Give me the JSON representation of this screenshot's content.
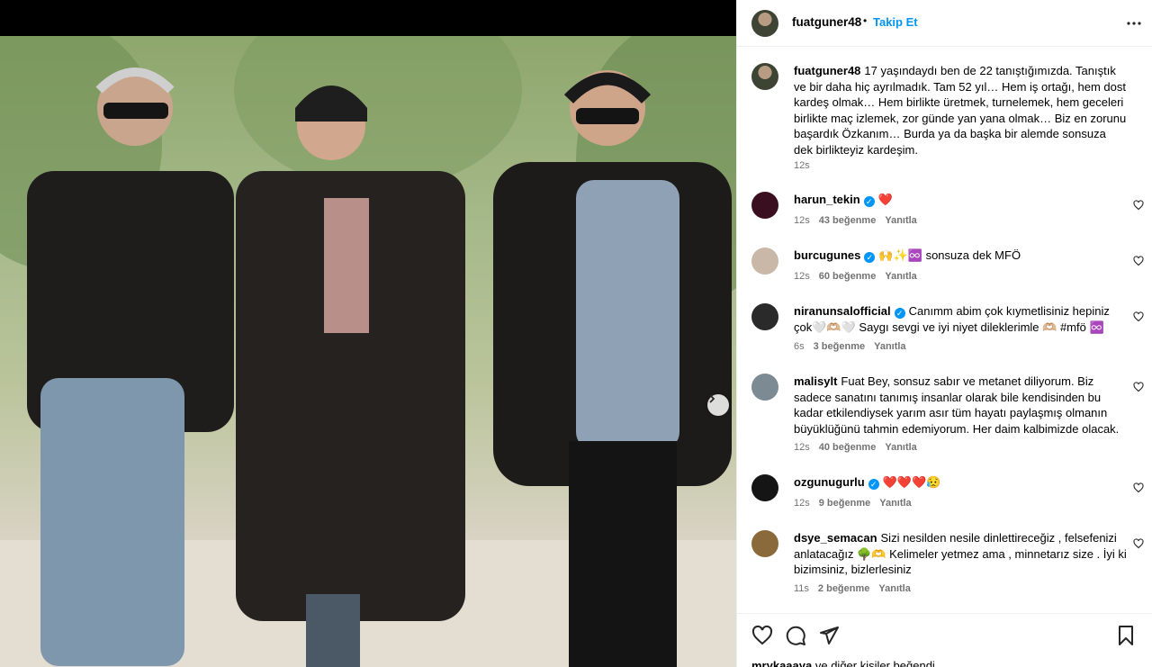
{
  "post": {
    "username": "fuatguner48",
    "separator": "•",
    "follow_label": "Takip Et",
    "caption": "17 yaşındaydı ben de 22 tanıştığımızda. Tanıştık ve bir daha hiç ayrılmadık. Tam 52 yıl… Hem iş ortağı, hem dost kardeş olmak… Hem birlikte üretmek, turnelemek, hem geceleri birlikte maç izlemek, zor günde yan yana olmak… Biz en zorunu başardık Özkanım… Burda ya da başka bir alemde sonsuza dek birlikteyiz kardeşim.",
    "caption_time": "12s"
  },
  "comments": [
    {
      "user": "harun_tekin",
      "verified": true,
      "text": "❤️",
      "time": "12s",
      "likes": "43 beğenme",
      "reply": "Yanıtla",
      "avatar_color": "#3a1020"
    },
    {
      "user": "burcugunes",
      "verified": true,
      "text": "🙌✨♾️ sonsuza dek MFÖ",
      "time": "12s",
      "likes": "60 beğenme",
      "reply": "Yanıtla",
      "avatar_color": "#c9b8a8"
    },
    {
      "user": "niranunsalofficial",
      "verified": true,
      "text": "Canımm abim çok kıymetlisiniz hepiniz çok🤍🫶🏼🤍 Saygı sevgi ve iyi niyet dileklerimle 🫶🏼 #mfö ♾️",
      "time": "6s",
      "likes": "3 beğenme",
      "reply": "Yanıtla",
      "avatar_color": "#2a2a2a"
    },
    {
      "user": "malisylt",
      "verified": false,
      "text": "Fuat Bey, sonsuz sabır ve metanet diliyorum. Biz sadece sanatını tanımış insanlar olarak bile kendisinden bu kadar etkilendiysek yarım asır tüm hayatı paylaşmış olmanın büyüklüğünü tahmin edemiyorum. Her daim kalbimizde olacak.",
      "time": "12s",
      "likes": "40 beğenme",
      "reply": "Yanıtla",
      "avatar_color": "#7c8a94"
    },
    {
      "user": "ozgunugurlu",
      "verified": true,
      "text": "❤️❤️❤️😥",
      "time": "12s",
      "likes": "9 beğenme",
      "reply": "Yanıtla",
      "avatar_color": "#151515"
    },
    {
      "user": "dsye_semacan",
      "verified": false,
      "text": "Sizi nesilden nesile dinlettireceğiz , felsefenizi anlatacağız 🌳🫶 Kelimeler yetmez ama , minnetarız size . İyi ki bizimsiniz, bizlerlesiniz",
      "time": "11s",
      "likes": "2 beğenme",
      "reply": "Yanıtla",
      "avatar_color": "#8a6a3a"
    }
  ],
  "footer": {
    "likers_name": "mrykaaaya",
    "likers_rest": "ve diğer kişiler beğendi"
  },
  "icons": {
    "more": "more-horizontal-icon",
    "next": "chevron-right-icon",
    "like": "heart-icon",
    "comment": "comment-icon",
    "share": "share-icon",
    "save": "bookmark-icon"
  }
}
